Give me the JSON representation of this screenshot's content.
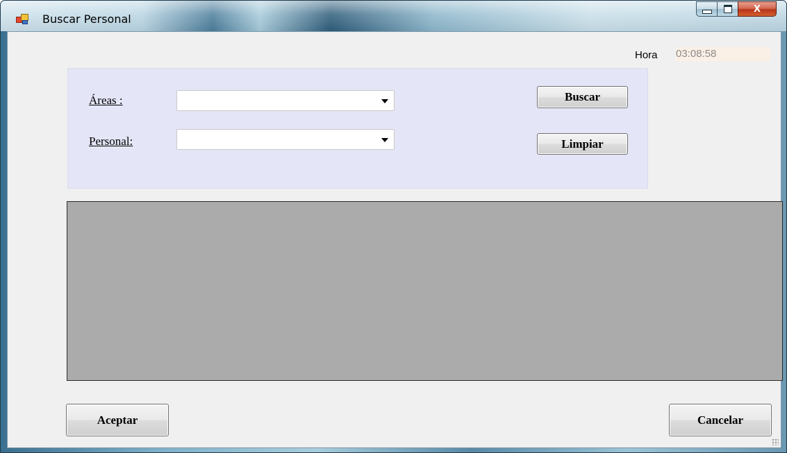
{
  "window": {
    "title": "Buscar Personal"
  },
  "caption_buttons": {
    "minimize": "",
    "maximize": "",
    "close": "X"
  },
  "time": {
    "label": "Hora",
    "value": "03:08:58"
  },
  "filters": {
    "areas_label": "Áreas :",
    "areas_value": "",
    "personal_label": "Personal:",
    "personal_value": ""
  },
  "buttons": {
    "search": "Buscar",
    "clear": "Limpiar",
    "accept": "Aceptar",
    "cancel": "Cancelar"
  },
  "colors": {
    "panel_background": "#e4e5f6",
    "grid_background": "#ababab",
    "time_background": "#fbf0e6"
  }
}
